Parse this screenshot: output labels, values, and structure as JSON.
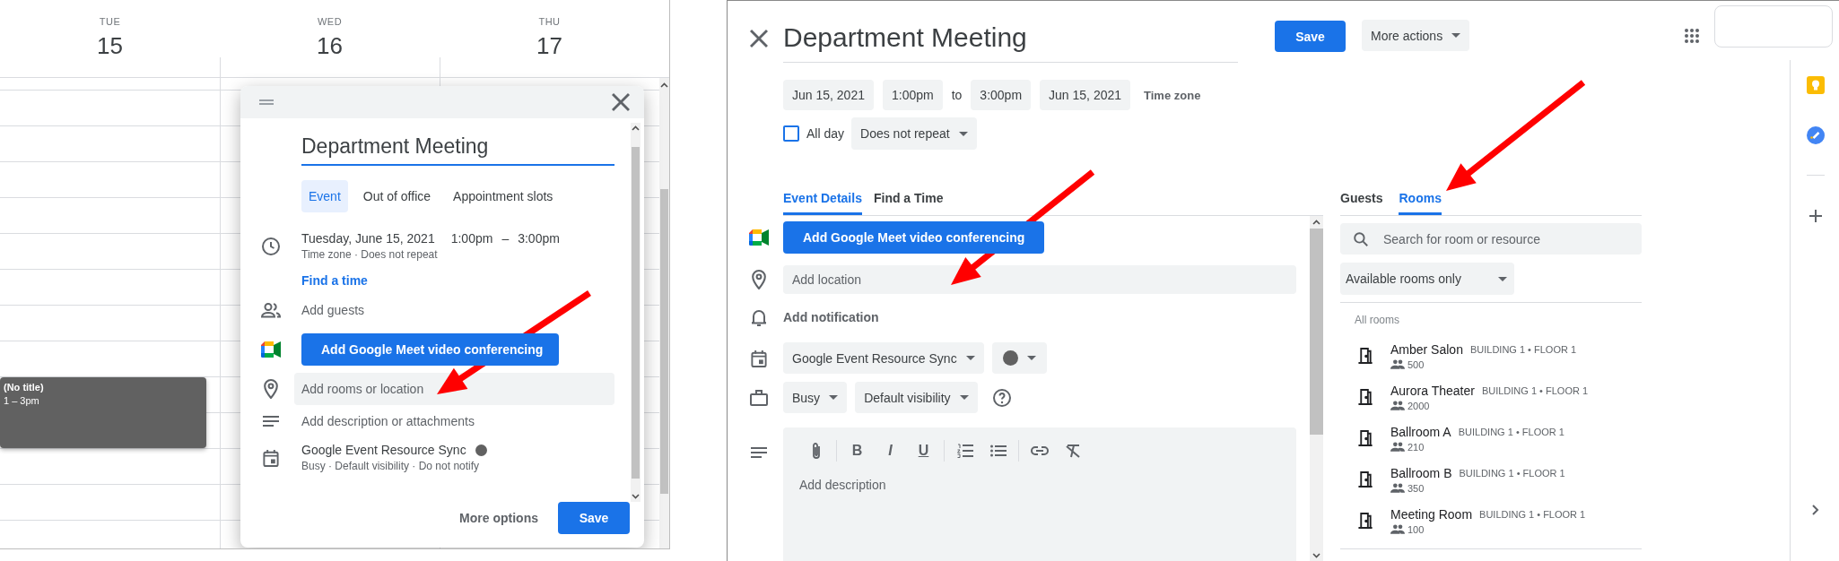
{
  "calendar_view": {
    "days": [
      {
        "weekday": "TUE",
        "date": "15"
      },
      {
        "weekday": "WED",
        "date": "16"
      },
      {
        "weekday": "THU",
        "date": "17"
      }
    ],
    "event": {
      "title": "(No title)",
      "time": "1 – 3pm"
    }
  },
  "quick_event_dialog": {
    "title": "Department Meeting",
    "tabs": [
      {
        "label": "Event",
        "selected": true
      },
      {
        "label": "Out of office",
        "selected": false
      },
      {
        "label": "Appointment slots",
        "selected": false
      }
    ],
    "date": "Tuesday, June 15, 2021",
    "start_time": "1:00pm",
    "separator": "–",
    "end_time": "3:00pm",
    "details": "Time zone · Does not repeat",
    "find_time_link": "Find a time",
    "guests_placeholder": "Add guests",
    "meet_button": "Add Google Meet video conferencing",
    "location_placeholder": "Add rooms or location",
    "description_placeholder": "Add description or attachments",
    "calendar": "Google Event Resource Sync",
    "calendar_details": "Busy · Default visibility · Do not notify",
    "more_options_button": "More options",
    "save_button": "Save"
  },
  "event_editor": {
    "title": "Department Meeting",
    "save_button": "Save",
    "more_actions": "More actions",
    "start_date": "Jun 15, 2021",
    "start_time": "1:00pm",
    "to_label": "to",
    "end_time": "3:00pm",
    "end_date": "Jun 15, 2021",
    "time_zone": "Time zone",
    "all_day": {
      "label": "All day",
      "checked": false
    },
    "repeat": "Does not repeat",
    "tabs": [
      {
        "label": "Event Details",
        "selected": true
      },
      {
        "label": "Find a Time",
        "selected": false
      }
    ],
    "meet_button": "Add Google Meet video conferencing",
    "location_placeholder": "Add location",
    "notification": "Add notification",
    "calendar": "Google Event Resource Sync",
    "availability": "Busy",
    "visibility": "Default visibility",
    "format_buttons": [
      "B",
      "I",
      "U"
    ],
    "description_placeholder": "Add description"
  },
  "side_panel": {
    "tabs": [
      {
        "label": "Guests",
        "selected": false
      },
      {
        "label": "Rooms",
        "selected": true
      }
    ],
    "search_placeholder": "Search for room or resource",
    "filter": "Available rooms only",
    "section_title": "All rooms",
    "rooms": [
      {
        "name": "Amber Salon",
        "location": "BUILDING 1 • FLOOR 1",
        "capacity": "500"
      },
      {
        "name": "Aurora Theater",
        "location": "BUILDING 1 • FLOOR 1",
        "capacity": "2000"
      },
      {
        "name": "Ballroom A",
        "location": "BUILDING 1 • FLOOR 1",
        "capacity": "210"
      },
      {
        "name": "Ballroom B",
        "location": "BUILDING 1 • FLOOR 1",
        "capacity": "350"
      },
      {
        "name": "Meeting Room",
        "location": "BUILDING 1 • FLOOR 1",
        "capacity": "100"
      }
    ]
  }
}
